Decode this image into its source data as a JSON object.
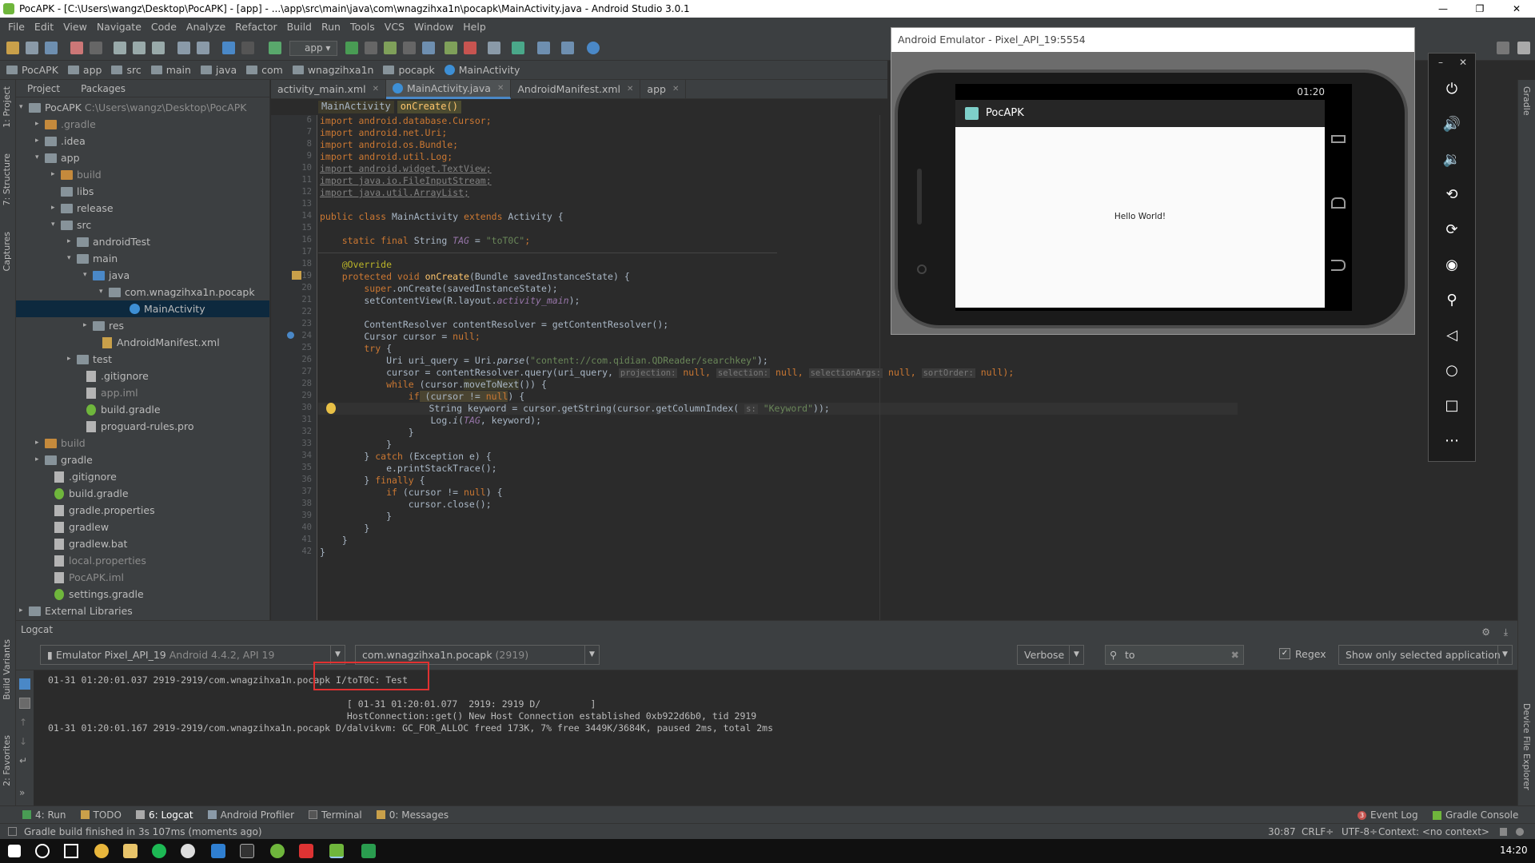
{
  "window": {
    "title": "PocAPK - [C:\\Users\\wangz\\Desktop\\PocAPK] - [app] - ...\\app\\src\\main\\java\\com\\wnagzihxa1n\\pocapk\\MainActivity.java - Android Studio 3.0.1"
  },
  "menu": [
    "File",
    "Edit",
    "View",
    "Navigate",
    "Code",
    "Analyze",
    "Refactor",
    "Build",
    "Run",
    "Tools",
    "VCS",
    "Window",
    "Help"
  ],
  "toolbar": {
    "run_config": "app"
  },
  "breadcrumb": [
    "PocAPK",
    "app",
    "src",
    "main",
    "java",
    "com",
    "wnagzihxa1n",
    "pocapk",
    "MainActivity"
  ],
  "left_stripe": {
    "project": "1: Project",
    "structure": "7: Structure",
    "captures": "Captures",
    "build_variants": "Build Variants",
    "favorites": "2: Favorites"
  },
  "project_panel": {
    "tabs": [
      "Project",
      "Packages"
    ],
    "tree": [
      {
        "label": "PocAPK",
        "extra": "C:\\Users\\wangz\\Desktop\\PocAPK"
      },
      {
        "label": ".gradle"
      },
      {
        "label": ".idea"
      },
      {
        "label": "app"
      },
      {
        "label": "build"
      },
      {
        "label": "libs"
      },
      {
        "label": "release"
      },
      {
        "label": "src"
      },
      {
        "label": "androidTest"
      },
      {
        "label": "main"
      },
      {
        "label": "java"
      },
      {
        "label": "com.wnagzihxa1n.pocapk"
      },
      {
        "label": "MainActivity"
      },
      {
        "label": "res"
      },
      {
        "label": "AndroidManifest.xml"
      },
      {
        "label": "test"
      },
      {
        "label": ".gitignore"
      },
      {
        "label": "app.iml"
      },
      {
        "label": "build.gradle"
      },
      {
        "label": "proguard-rules.pro"
      },
      {
        "label": "build"
      },
      {
        "label": "gradle"
      },
      {
        "label": ".gitignore"
      },
      {
        "label": "build.gradle"
      },
      {
        "label": "gradle.properties"
      },
      {
        "label": "gradlew"
      },
      {
        "label": "gradlew.bat"
      },
      {
        "label": "local.properties"
      },
      {
        "label": "PocAPK.iml"
      },
      {
        "label": "settings.gradle"
      },
      {
        "label": "External Libraries"
      }
    ]
  },
  "editor": {
    "tabs": [
      "activity_main.xml",
      "MainActivity.java",
      "AndroidManifest.xml",
      "app"
    ],
    "crumbs": [
      "MainActivity",
      "onCreate()"
    ],
    "line_numbers": [
      "6",
      "7",
      "8",
      "9",
      "10",
      "11",
      "12",
      "13",
      "14",
      "15",
      "16",
      "17",
      "18",
      "19",
      "20",
      "21",
      "22",
      "23",
      "24",
      "25",
      "26",
      "27",
      "28",
      "29",
      "30",
      "31",
      "32",
      "33",
      "34",
      "35",
      "36",
      "37",
      "38",
      "39",
      "40",
      "41",
      "42"
    ],
    "code": {
      "l6": "import android.database.Cursor;",
      "l7": "import android.net.Uri;",
      "l8": "import android.os.Bundle;",
      "l9": "import android.util.Log;",
      "l10": "import android.widget.TextView;",
      "l11": "import java.io.FileInputStream;",
      "l12": "import java.util.ArrayList;",
      "l14a": "public class ",
      "l14b": "MainActivity ",
      "l14c": "extends ",
      "l14d": "Activity {",
      "l16a": "    static final ",
      "l16b": "String ",
      "l16c": "TAG",
      "l16d": " = ",
      "l16e": "\"toT0C\"",
      "l16f": ";",
      "l18": "    @Override",
      "l19a": "    protected void ",
      "l19b": "onCreate",
      "l19c": "(Bundle savedInstanceState) {",
      "l20a": "        super",
      "l20b": ".onCreate(savedInstanceState);",
      "l21a": "        setContentView(R.layout.",
      "l21b": "activity_main",
      "l21c": ");",
      "l23": "        ContentResolver contentResolver = getContentResolver();",
      "l24a": "        Cursor cursor = ",
      "l24b": "null",
      "l24c": ";",
      "l25a": "        try",
      "l25b": " {",
      "l26a": "            Uri uri_query = Uri.",
      "l26b": "parse",
      "l26c": "(",
      "l26d": "\"content://com.qidian.QDReader/searchkey\"",
      "l26e": ");",
      "l27a": "            cursor = contentResolver.query(uri_query, ",
      "l27h1": "projection:",
      "l27n1": " null, ",
      "l27h2": "selection:",
      "l27n2": " null, ",
      "l27h3": "selectionArgs:",
      "l27n3": " null, ",
      "l27h4": "sortOrder:",
      "l27n4": " null);",
      "l28a": "            while",
      "l28b": " (cursor.",
      "l28c": "moveToNext",
      "l28d": "()) {",
      "l29a": "                if",
      "l29b": " (cursor != ",
      "l29c": "null",
      "l29d": ") {",
      "l30a": "                    String keyword = cursor.getString(cursor.getColumnIndex( ",
      "l30h": "s:",
      "l30b": " \"Keyword\"",
      "l30c": "));",
      "l31a": "                    Log.",
      "l31b": "i",
      "l31c": "(",
      "l31d": "TAG",
      "l31e": ", keyword);",
      "l32": "                }",
      "l33": "            }",
      "l34a": "        } ",
      "l34b": "catch",
      "l34c": " (Exception e) {",
      "l35": "            e.printStackTrace();",
      "l36a": "        } ",
      "l36b": "finally",
      "l36c": " {",
      "l37a": "            if",
      "l37b": " (cursor != ",
      "l37c": "null",
      "l37d": ") {",
      "l38": "                cursor.close();",
      "l39": "            }",
      "l40": "        }",
      "l41": "    }",
      "l42": "}"
    }
  },
  "emulator": {
    "title": "Android Emulator - Pixel_API_19:5554",
    "clock": "01:20",
    "app_name": "PocAPK",
    "content_text": "Hello World!"
  },
  "emulator_toolbar": [
    "power-icon",
    "volume-up-icon",
    "volume-down-icon",
    "rotate-left-icon",
    "rotate-right-icon",
    "camera-icon",
    "zoom-icon",
    "back-icon",
    "home-icon",
    "overview-icon",
    "more-icon"
  ],
  "right_stripe": {
    "gradle": "Gradle",
    "device_file_explorer": "Device File Explorer"
  },
  "logcat": {
    "title": "Logcat",
    "device": "Emulator Pixel_API_19",
    "device_detail": "Android 4.4.2, API 19",
    "process": "com.wnagzihxa1n.pocapk",
    "process_pid": "(2919)",
    "level": "Verbose",
    "search": "to",
    "regex_label": "Regex",
    "regex_checked": true,
    "filter": "Show only selected application",
    "lines": [
      "01-31 01:20:01.037 2919-2919/com.wnagzihxa1n.pocapk I/toT0C: Test",
      "                                                      [ 01-31 01:20:01.077  2919: 2919 D/         ]",
      "                                                      HostConnection::get() New Host Connection established 0xb922d6b0, tid 2919",
      "01-31 01:20:01.167 2919-2919/com.wnagzihxa1n.pocapk D/dalvikvm: GC_FOR_ALLOC freed 173K, 7% free 3449K/3684K, paused 2ms, total 2ms"
    ]
  },
  "tool_tabs": [
    {
      "label": "4: Run"
    },
    {
      "label": "TODO"
    },
    {
      "label": "6: Logcat"
    },
    {
      "label": "Android Profiler"
    },
    {
      "label": "Terminal"
    },
    {
      "label": "0: Messages"
    }
  ],
  "tool_tabs_right": [
    "Event Log",
    "Gradle Console"
  ],
  "event_log_count": "3",
  "statusbar": {
    "message": "Gradle build finished in 3s 107ms (moments ago)",
    "position": "30:87",
    "line_sep": "CRLF÷",
    "encoding": "UTF-8÷",
    "context": "Context: <no context>"
  },
  "taskbar": {
    "time": "14:20"
  },
  "colors": {
    "accent": "#4a88c7",
    "highlight_box": "#e03131",
    "background": "#2b2b2b",
    "panel": "#3c3f41"
  }
}
